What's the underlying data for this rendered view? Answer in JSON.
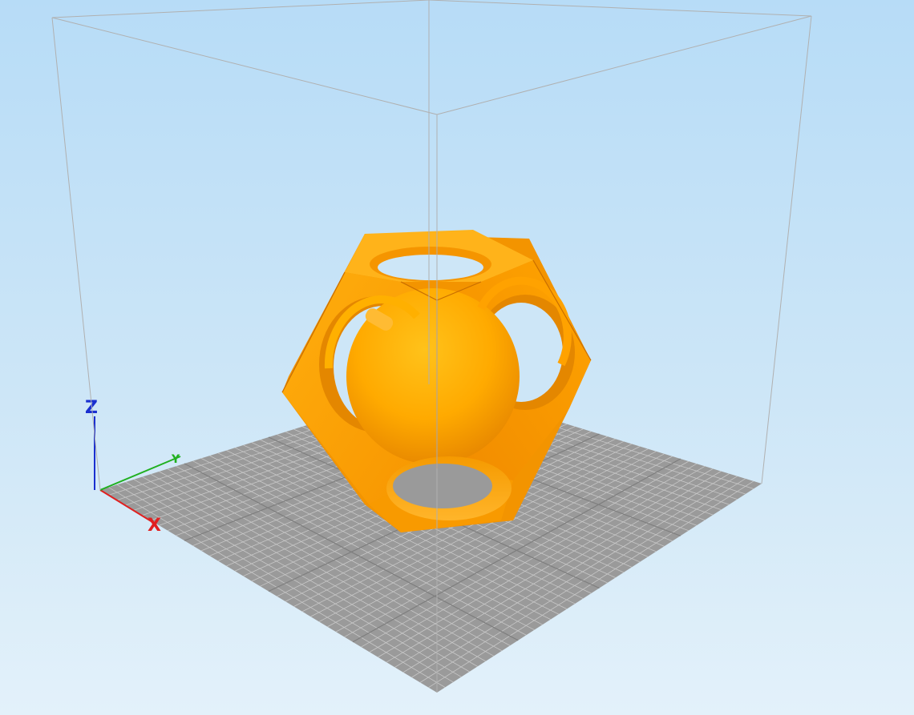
{
  "viewport": {
    "background_top": "#b7dcf7",
    "background_bottom": "#e3f1fa"
  },
  "axes": {
    "x": {
      "label": "X",
      "color": "#e02020"
    },
    "y": {
      "label": "Y",
      "color": "#20b020"
    },
    "z": {
      "label": "Z",
      "color": "#1a2fd0"
    }
  },
  "bed": {
    "color": "#9a9a9a",
    "grid_color": "#c8c8c8"
  },
  "model": {
    "shape": "dodecahedron cage with captive sphere",
    "color": "#ffa500"
  }
}
